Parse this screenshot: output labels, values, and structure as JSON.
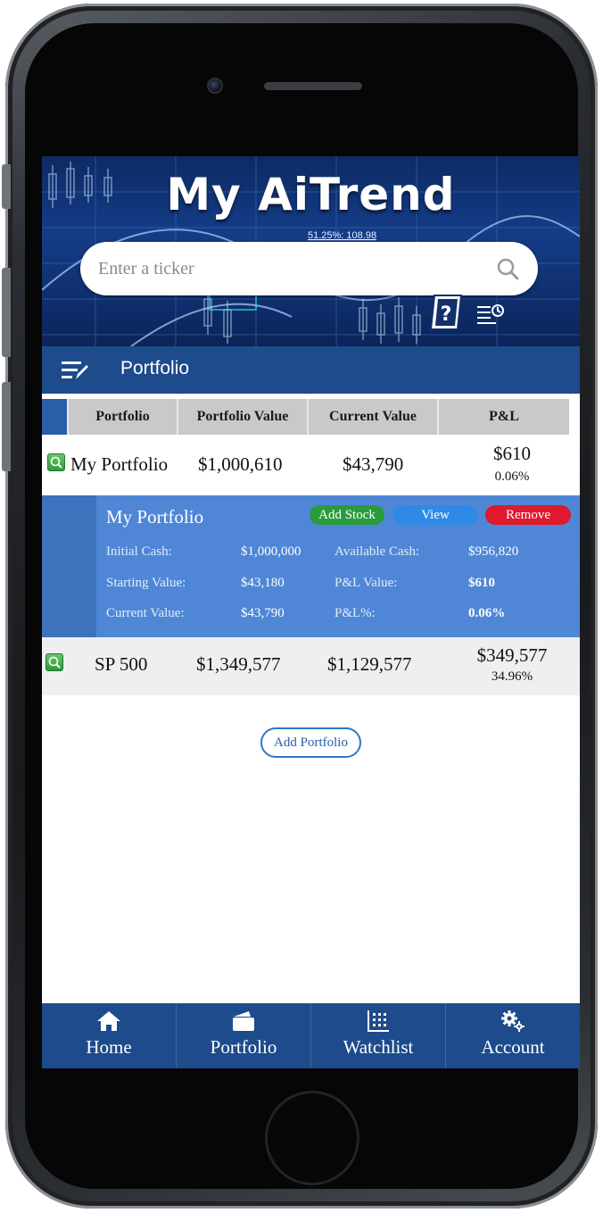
{
  "app": {
    "logo": "My AiTrend"
  },
  "search": {
    "placeholder": "Enter a ticker"
  },
  "section": {
    "title": "Portfolio"
  },
  "table": {
    "headers": [
      "Portfolio",
      "Portfolio Value",
      "Current Value",
      "P&L"
    ],
    "rows": [
      {
        "name": "My Portfolio",
        "portfolio_value": "$1,000,610",
        "current_value": "$43,790",
        "pl": "$610",
        "pl_pct": "0.06%"
      },
      {
        "name": "SP 500",
        "portfolio_value": "$1,349,577",
        "current_value": "$1,129,577",
        "pl": "$349,577",
        "pl_pct": "34.96%"
      }
    ]
  },
  "detail": {
    "name": "My Portfolio",
    "buttons": {
      "add_stock": "Add Stock",
      "view": "View",
      "remove": "Remove"
    },
    "initial_cash_label": "Initial Cash:",
    "initial_cash": "$1,000,000",
    "available_cash_label": "Available Cash:",
    "available_cash": "$956,820",
    "starting_value_label": "Starting Value:",
    "starting_value": "$43,180",
    "pl_value_label": "P&L Value:",
    "pl_value": "$610",
    "current_value_label": "Current Value:",
    "current_value": "$43,790",
    "pl_pct_label": "P&L%:",
    "pl_pct": "0.06%"
  },
  "add_portfolio": "Add Portfolio",
  "nav": [
    {
      "label": "Home",
      "icon": "home-icon"
    },
    {
      "label": "Portfolio",
      "icon": "wallet-icon"
    },
    {
      "label": "Watchlist",
      "icon": "watchlist-icon"
    },
    {
      "label": "Account",
      "icon": "gears-icon"
    }
  ],
  "colors": {
    "primary_bar": "#1d4b8c",
    "detail_panel": "#4f87d6",
    "add_stock": "#2a9b3c",
    "view": "#2e8ae6",
    "remove": "#e0192e"
  }
}
